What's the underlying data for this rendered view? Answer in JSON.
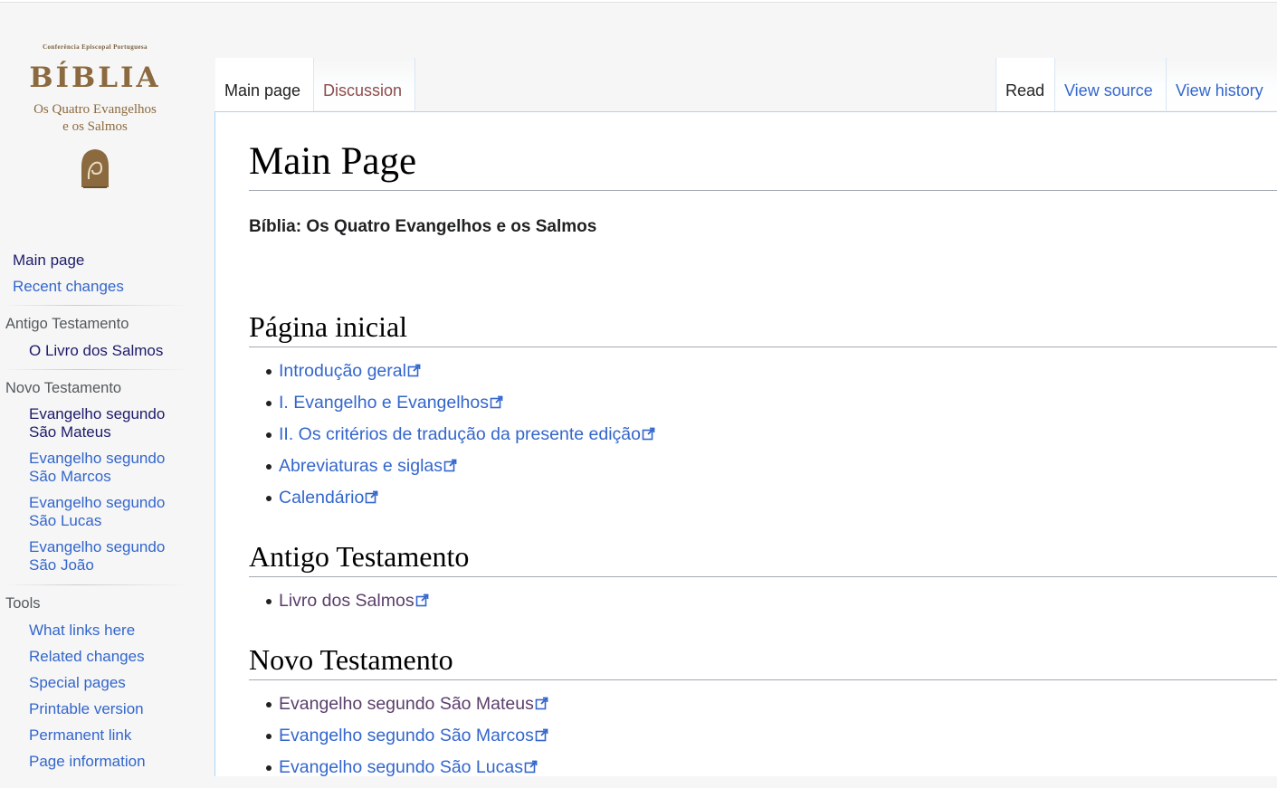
{
  "logo": {
    "small_text": "Conferência Episcopal Portuguesa",
    "title": "BÍBLIA",
    "subtitle_line1": "Os Quatro Evangelhos",
    "subtitle_line2": "e os Salmos"
  },
  "sidebar": {
    "main_page": "Main page",
    "recent_changes": "Recent changes",
    "antigo": {
      "heading": "Antigo Testamento",
      "items": [
        "O Livro dos Salmos"
      ]
    },
    "novo": {
      "heading": "Novo Testamento",
      "items": [
        {
          "line1": "Evangelho segundo",
          "line2": "São Mateus"
        },
        {
          "line1": "Evangelho segundo",
          "line2": "São Marcos"
        },
        {
          "line1": "Evangelho segundo",
          "line2": "São Lucas"
        },
        {
          "line1": "Evangelho segundo",
          "line2": "São João"
        }
      ]
    },
    "tools": {
      "heading": "Tools",
      "items": [
        "What links here",
        "Related changes",
        "Special pages",
        "Printable version",
        "Permanent link",
        "Page information"
      ]
    }
  },
  "tabs": {
    "main_page": "Main page",
    "discussion": "Discussion",
    "read": "Read",
    "view_source": "View source",
    "view_history": "View history"
  },
  "page": {
    "title": "Main Page",
    "subtitle": "Bíblia: Os Quatro Evangelhos e os Salmos",
    "sections": [
      {
        "heading": "Página inicial",
        "items": [
          "Introdução geral",
          "I. Evangelho e Evangelhos",
          "II. Os critérios de tradução da presente edição",
          "Abreviaturas e siglas",
          "Calendário"
        ]
      },
      {
        "heading": "Antigo Testamento",
        "items": [
          "Livro dos Salmos"
        ]
      },
      {
        "heading": "Novo Testamento",
        "items": [
          "Evangelho segundo São Mateus",
          "Evangelho segundo São Marcos",
          "Evangelho segundo São Lucas"
        ]
      }
    ]
  },
  "colors": {
    "link": "#3366cc",
    "visited": "#5a3e6b",
    "logo_gold": "#8c6a3f",
    "border_blue": "#a7d7f9"
  }
}
